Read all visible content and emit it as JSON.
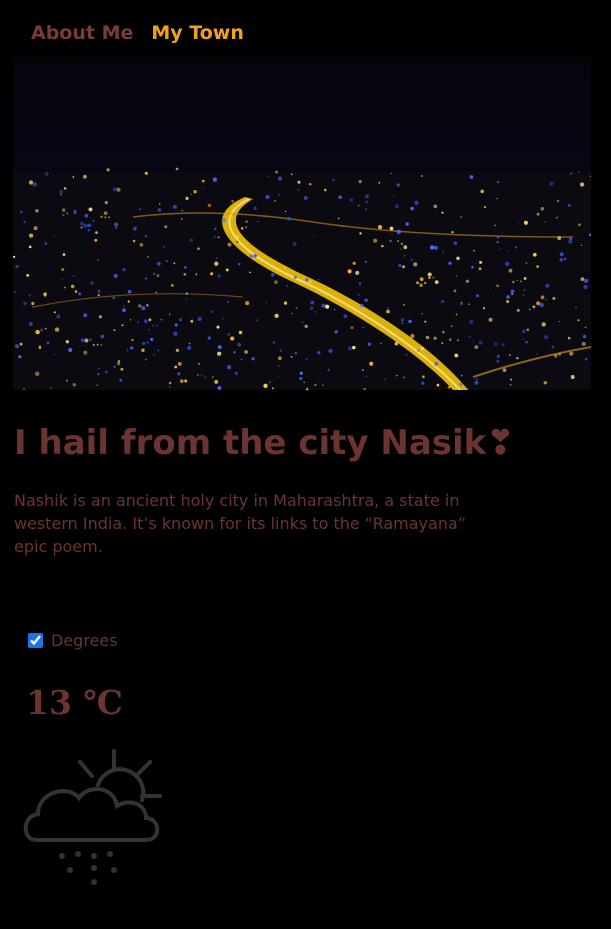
{
  "nav": {
    "items": [
      {
        "label": "About Me",
        "color": "#7a3d36"
      },
      {
        "label": "My Town",
        "color": "#f0a11f"
      }
    ]
  },
  "hero": {
    "alt": "Night aerial view of a city with a lit highway"
  },
  "main": {
    "title": "I hail from the city Nasik",
    "title_emoji": "❣",
    "description": "Nashik is an ancient holy city in Maharashtra, a state in western India. It’s known for its links to the “Ramayana” epic poem."
  },
  "weather": {
    "toggle_label": "Degrees",
    "toggle_checked": true,
    "temperature": "13 ℃",
    "icon": "cloud-sun-snow-icon"
  },
  "colors": {
    "background": "#000000",
    "text": "#6b3431",
    "accent": "#f0a11f"
  }
}
